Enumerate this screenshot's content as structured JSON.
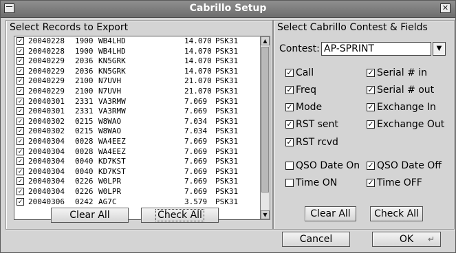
{
  "window": {
    "title": "Cabrillo Setup"
  },
  "left_panel": {
    "title": "Select Records to Export",
    "records": [
      {
        "date": "20040228",
        "time": "1900",
        "call": "WB4LHD",
        "freq": "14.070",
        "mode": "PSK31",
        "checked": true
      },
      {
        "date": "20040228",
        "time": "1900",
        "call": "WB4LHD",
        "freq": "14.070",
        "mode": "PSK31",
        "checked": true
      },
      {
        "date": "20040229",
        "time": "2036",
        "call": "KN5GRK",
        "freq": "14.070",
        "mode": "PSK31",
        "checked": true
      },
      {
        "date": "20040229",
        "time": "2036",
        "call": "KN5GRK",
        "freq": "14.070",
        "mode": "PSK31",
        "checked": true
      },
      {
        "date": "20040229",
        "time": "2100",
        "call": "N7UVH",
        "freq": "21.070",
        "mode": "PSK31",
        "checked": true
      },
      {
        "date": "20040229",
        "time": "2100",
        "call": "N7UVH",
        "freq": "21.070",
        "mode": "PSK31",
        "checked": true
      },
      {
        "date": "20040301",
        "time": "2331",
        "call": "VA3RMW",
        "freq": "7.069",
        "mode": "PSK31",
        "checked": true
      },
      {
        "date": "20040301",
        "time": "2331",
        "call": "VA3RMW",
        "freq": "7.069",
        "mode": "PSK31",
        "checked": true
      },
      {
        "date": "20040302",
        "time": "0215",
        "call": "W8WAO",
        "freq": "7.034",
        "mode": "PSK31",
        "checked": true
      },
      {
        "date": "20040302",
        "time": "0215",
        "call": "W8WAO",
        "freq": "7.034",
        "mode": "PSK31",
        "checked": true
      },
      {
        "date": "20040304",
        "time": "0028",
        "call": "WA4EEZ",
        "freq": "7.069",
        "mode": "PSK31",
        "checked": true
      },
      {
        "date": "20040304",
        "time": "0028",
        "call": "WA4EEZ",
        "freq": "7.069",
        "mode": "PSK31",
        "checked": true
      },
      {
        "date": "20040304",
        "time": "0040",
        "call": "KD7KST",
        "freq": "7.069",
        "mode": "PSK31",
        "checked": true
      },
      {
        "date": "20040304",
        "time": "0040",
        "call": "KD7KST",
        "freq": "7.069",
        "mode": "PSK31",
        "checked": true
      },
      {
        "date": "20040304",
        "time": "0226",
        "call": "W0LPR",
        "freq": "7.069",
        "mode": "PSK31",
        "checked": true
      },
      {
        "date": "20040304",
        "time": "0226",
        "call": "W0LPR",
        "freq": "7.069",
        "mode": "PSK31",
        "checked": true
      },
      {
        "date": "20040306",
        "time": "0242",
        "call": "AG7C",
        "freq": "3.579",
        "mode": "PSK31",
        "checked": true
      }
    ],
    "clear_all": "Clear All",
    "check_all": "Check All"
  },
  "right_panel": {
    "title": "Select Cabrillo Contest & Fields",
    "contest_label": "Contest:",
    "contest_value": "AP-SPRINT",
    "fields": [
      {
        "label": "Call",
        "checked": true
      },
      {
        "label": "Serial # in",
        "checked": true
      },
      {
        "label": "Freq",
        "checked": true
      },
      {
        "label": "Serial # out",
        "checked": true
      },
      {
        "label": "Mode",
        "checked": true
      },
      {
        "label": "Exchange In",
        "checked": true
      },
      {
        "label": "RST sent",
        "checked": true
      },
      {
        "label": "Exchange Out",
        "checked": true
      },
      {
        "label": "RST rcvd",
        "checked": true
      },
      {
        "label": "QSO Date On",
        "checked": false
      },
      {
        "label": "QSO Date Off",
        "checked": true
      },
      {
        "label": "Time ON",
        "checked": false
      },
      {
        "label": "Time OFF",
        "checked": true
      }
    ],
    "clear_all": "Clear All",
    "check_all": "Check All"
  },
  "footer": {
    "cancel": "Cancel",
    "ok": "OK"
  }
}
